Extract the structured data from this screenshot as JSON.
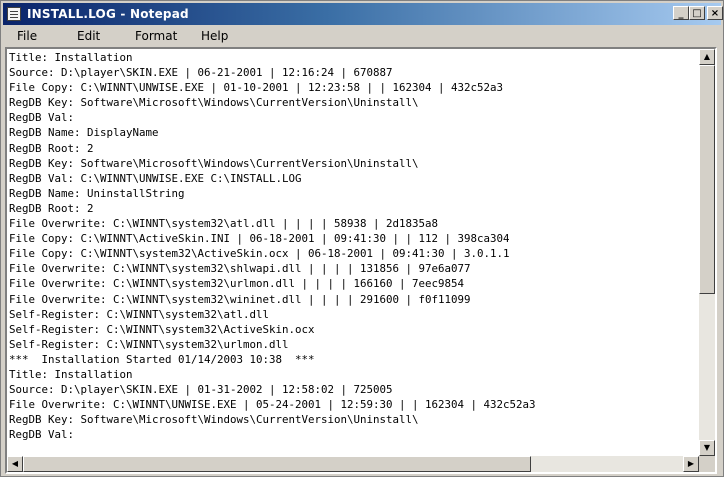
{
  "window": {
    "title": "INSTALL.LOG - Notepad",
    "icon": "notepad-icon",
    "controls": {
      "minimize": "_",
      "maximize": "□",
      "close": "×"
    }
  },
  "menu": {
    "file": "File",
    "edit": "Edit",
    "format": "Format",
    "help": "Help"
  },
  "log_lines": [
    "Title: Installation",
    "Source: D:\\player\\SKIN.EXE | 06-21-2001 | 12:16:24 | 670887",
    "File Copy: C:\\WINNT\\UNWISE.EXE | 01-10-2001 | 12:23:58 | | 162304 | 432c52a3",
    "RegDB Key: Software\\Microsoft\\Windows\\CurrentVersion\\Uninstall\\",
    "RegDB Val:",
    "RegDB Name: DisplayName",
    "RegDB Root: 2",
    "RegDB Key: Software\\Microsoft\\Windows\\CurrentVersion\\Uninstall\\",
    "RegDB Val: C:\\WINNT\\UNWISE.EXE C:\\INSTALL.LOG",
    "RegDB Name: UninstallString",
    "RegDB Root: 2",
    "File Overwrite: C:\\WINNT\\system32\\atl.dll | | | | 58938 | 2d1835a8",
    "File Copy: C:\\WINNT\\ActiveSkin.INI | 06-18-2001 | 09:41:30 | | 112 | 398ca304",
    "File Copy: C:\\WINNT\\system32\\ActiveSkin.ocx | 06-18-2001 | 09:41:30 | 3.0.1.1",
    "File Overwrite: C:\\WINNT\\system32\\shlwapi.dll | | | | 131856 | 97e6a077",
    "File Overwrite: C:\\WINNT\\system32\\urlmon.dll | | | | 166160 | 7eec9854",
    "File Overwrite: C:\\WINNT\\system32\\wininet.dll | | | | 291600 | f0f11099",
    "Self-Register: C:\\WINNT\\system32\\atl.dll",
    "Self-Register: C:\\WINNT\\system32\\ActiveSkin.ocx",
    "Self-Register: C:\\WINNT\\system32\\urlmon.dll",
    "***  Installation Started 01/14/2003 10:38  ***",
    "Title: Installation",
    "Source: D:\\player\\SKIN.EXE | 01-31-2002 | 12:58:02 | 725005",
    "File Overwrite: C:\\WINNT\\UNWISE.EXE | 05-24-2001 | 12:59:30 | | 162304 | 432c52a3",
    "RegDB Key: Software\\Microsoft\\Windows\\CurrentVersion\\Uninstall\\",
    "RegDB Val:"
  ],
  "scrollbars": {
    "up_arrow": "▲",
    "down_arrow": "▼",
    "left_arrow": "◀",
    "right_arrow": "▶"
  }
}
